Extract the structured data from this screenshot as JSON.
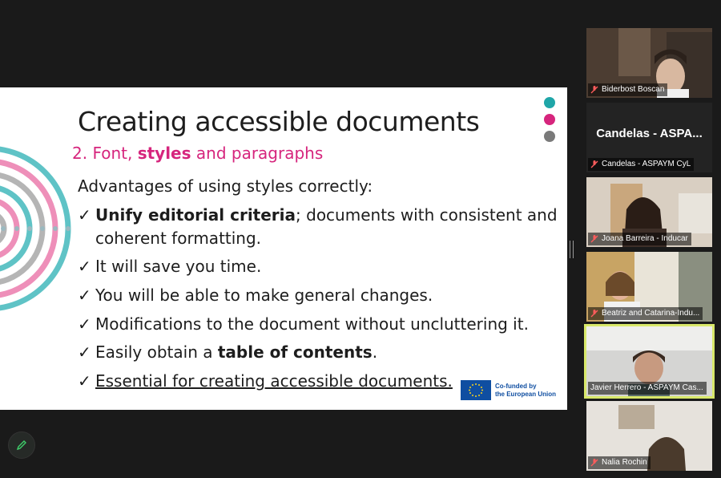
{
  "slide": {
    "title": "Creating accessible documents",
    "subtitle_prefix": "2. Font, ",
    "subtitle_bold": "styles",
    "subtitle_suffix": " and paragraphs",
    "intro": "Advantages of using styles correctly:",
    "bullets": [
      {
        "bold": "Unify editorial criteria",
        "text": "; documents with consistent and",
        "cont": "coherent formatting."
      },
      {
        "text": "It will save you time."
      },
      {
        "text": "You will be able to make general changes."
      },
      {
        "text": "Modifications to the document without uncluttering it."
      },
      {
        "pre": "Easily obtain a ",
        "bold": "table of contents",
        "post": "."
      },
      {
        "underline": "Essential for creating accessible documents."
      }
    ],
    "check_glyph": "✓",
    "eu_line1": "Co-funded by",
    "eu_line2": "the European Union",
    "colors": {
      "teal": "#1fa6a8",
      "pink": "#d6257d",
      "gray": "#7a7a7a",
      "arc_teal": "#5fc3c6",
      "arc_pink": "#ee8fb9",
      "arc_gray": "#b5b5b5"
    }
  },
  "participants": [
    {
      "name": "Biderbost Boscan",
      "muted": true,
      "video": true
    },
    {
      "name": "Candelas - ASPAYM CyL",
      "display_name": "Candelas - ASPA...",
      "muted": true,
      "video": false
    },
    {
      "name": "Joana Barreira - Inducar",
      "muted": true,
      "video": true
    },
    {
      "name": "Beatriz and Catarina-Indu...",
      "muted": true,
      "video": true
    },
    {
      "name": "Javier Herrero - ASPAYM Cas...",
      "muted": false,
      "video": true,
      "active": true
    },
    {
      "name": "Nalia Rochin",
      "muted": true,
      "video": true
    }
  ],
  "icons": {
    "annotate": "pencil-icon",
    "muted": "mic-muted-icon"
  }
}
